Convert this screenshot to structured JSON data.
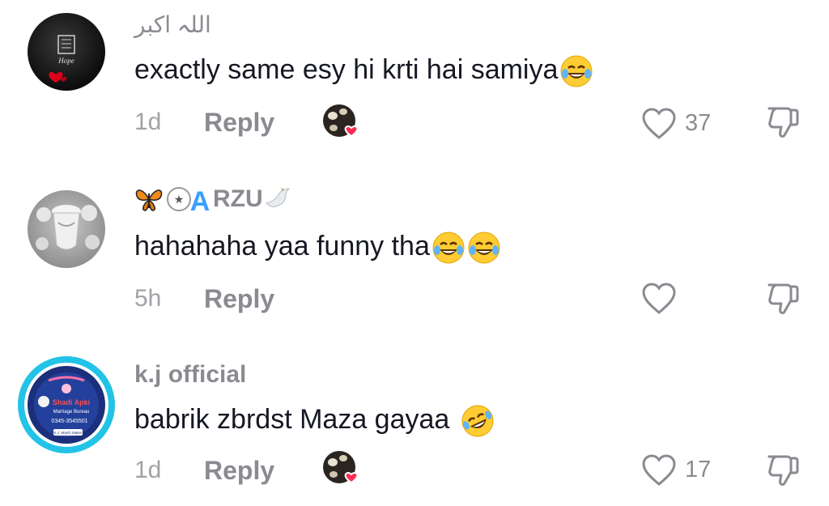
{
  "comments": [
    {
      "username": "اللہ اکبر",
      "text": "exactly same esy hi krti hai samiya",
      "emoji": [
        "😂"
      ],
      "time": "1d",
      "reply_label": "Reply",
      "likes": "37",
      "liked_by_creator": true,
      "avatar_text": [
        "Hope"
      ]
    },
    {
      "username": "RZU",
      "username_prefix_icons": [
        "butterfly",
        "star-circle",
        "letter-A"
      ],
      "username_suffix_icon": "dove",
      "text": "hahahaha yaa funny tha",
      "emoji": [
        "😂",
        "😂"
      ],
      "time": "5h",
      "reply_label": "Reply",
      "likes": "",
      "liked_by_creator": false
    },
    {
      "username": "k.j official",
      "text": "babrik zbrdst Maza gayaa",
      "emoji": [
        "🤣"
      ],
      "time": "1d",
      "reply_label": "Reply",
      "likes": "17",
      "liked_by_creator": true,
      "avatar_text": [
        "Shadi Apki",
        "Marriage Bureau",
        "0345-3545501",
        "K.J. Match Maker"
      ]
    }
  ],
  "colors": {
    "text_primary": "#161823",
    "text_secondary": "#8a8b91",
    "heart_red": "#fe2c55",
    "avatar3_ring": "#22c3e6"
  }
}
